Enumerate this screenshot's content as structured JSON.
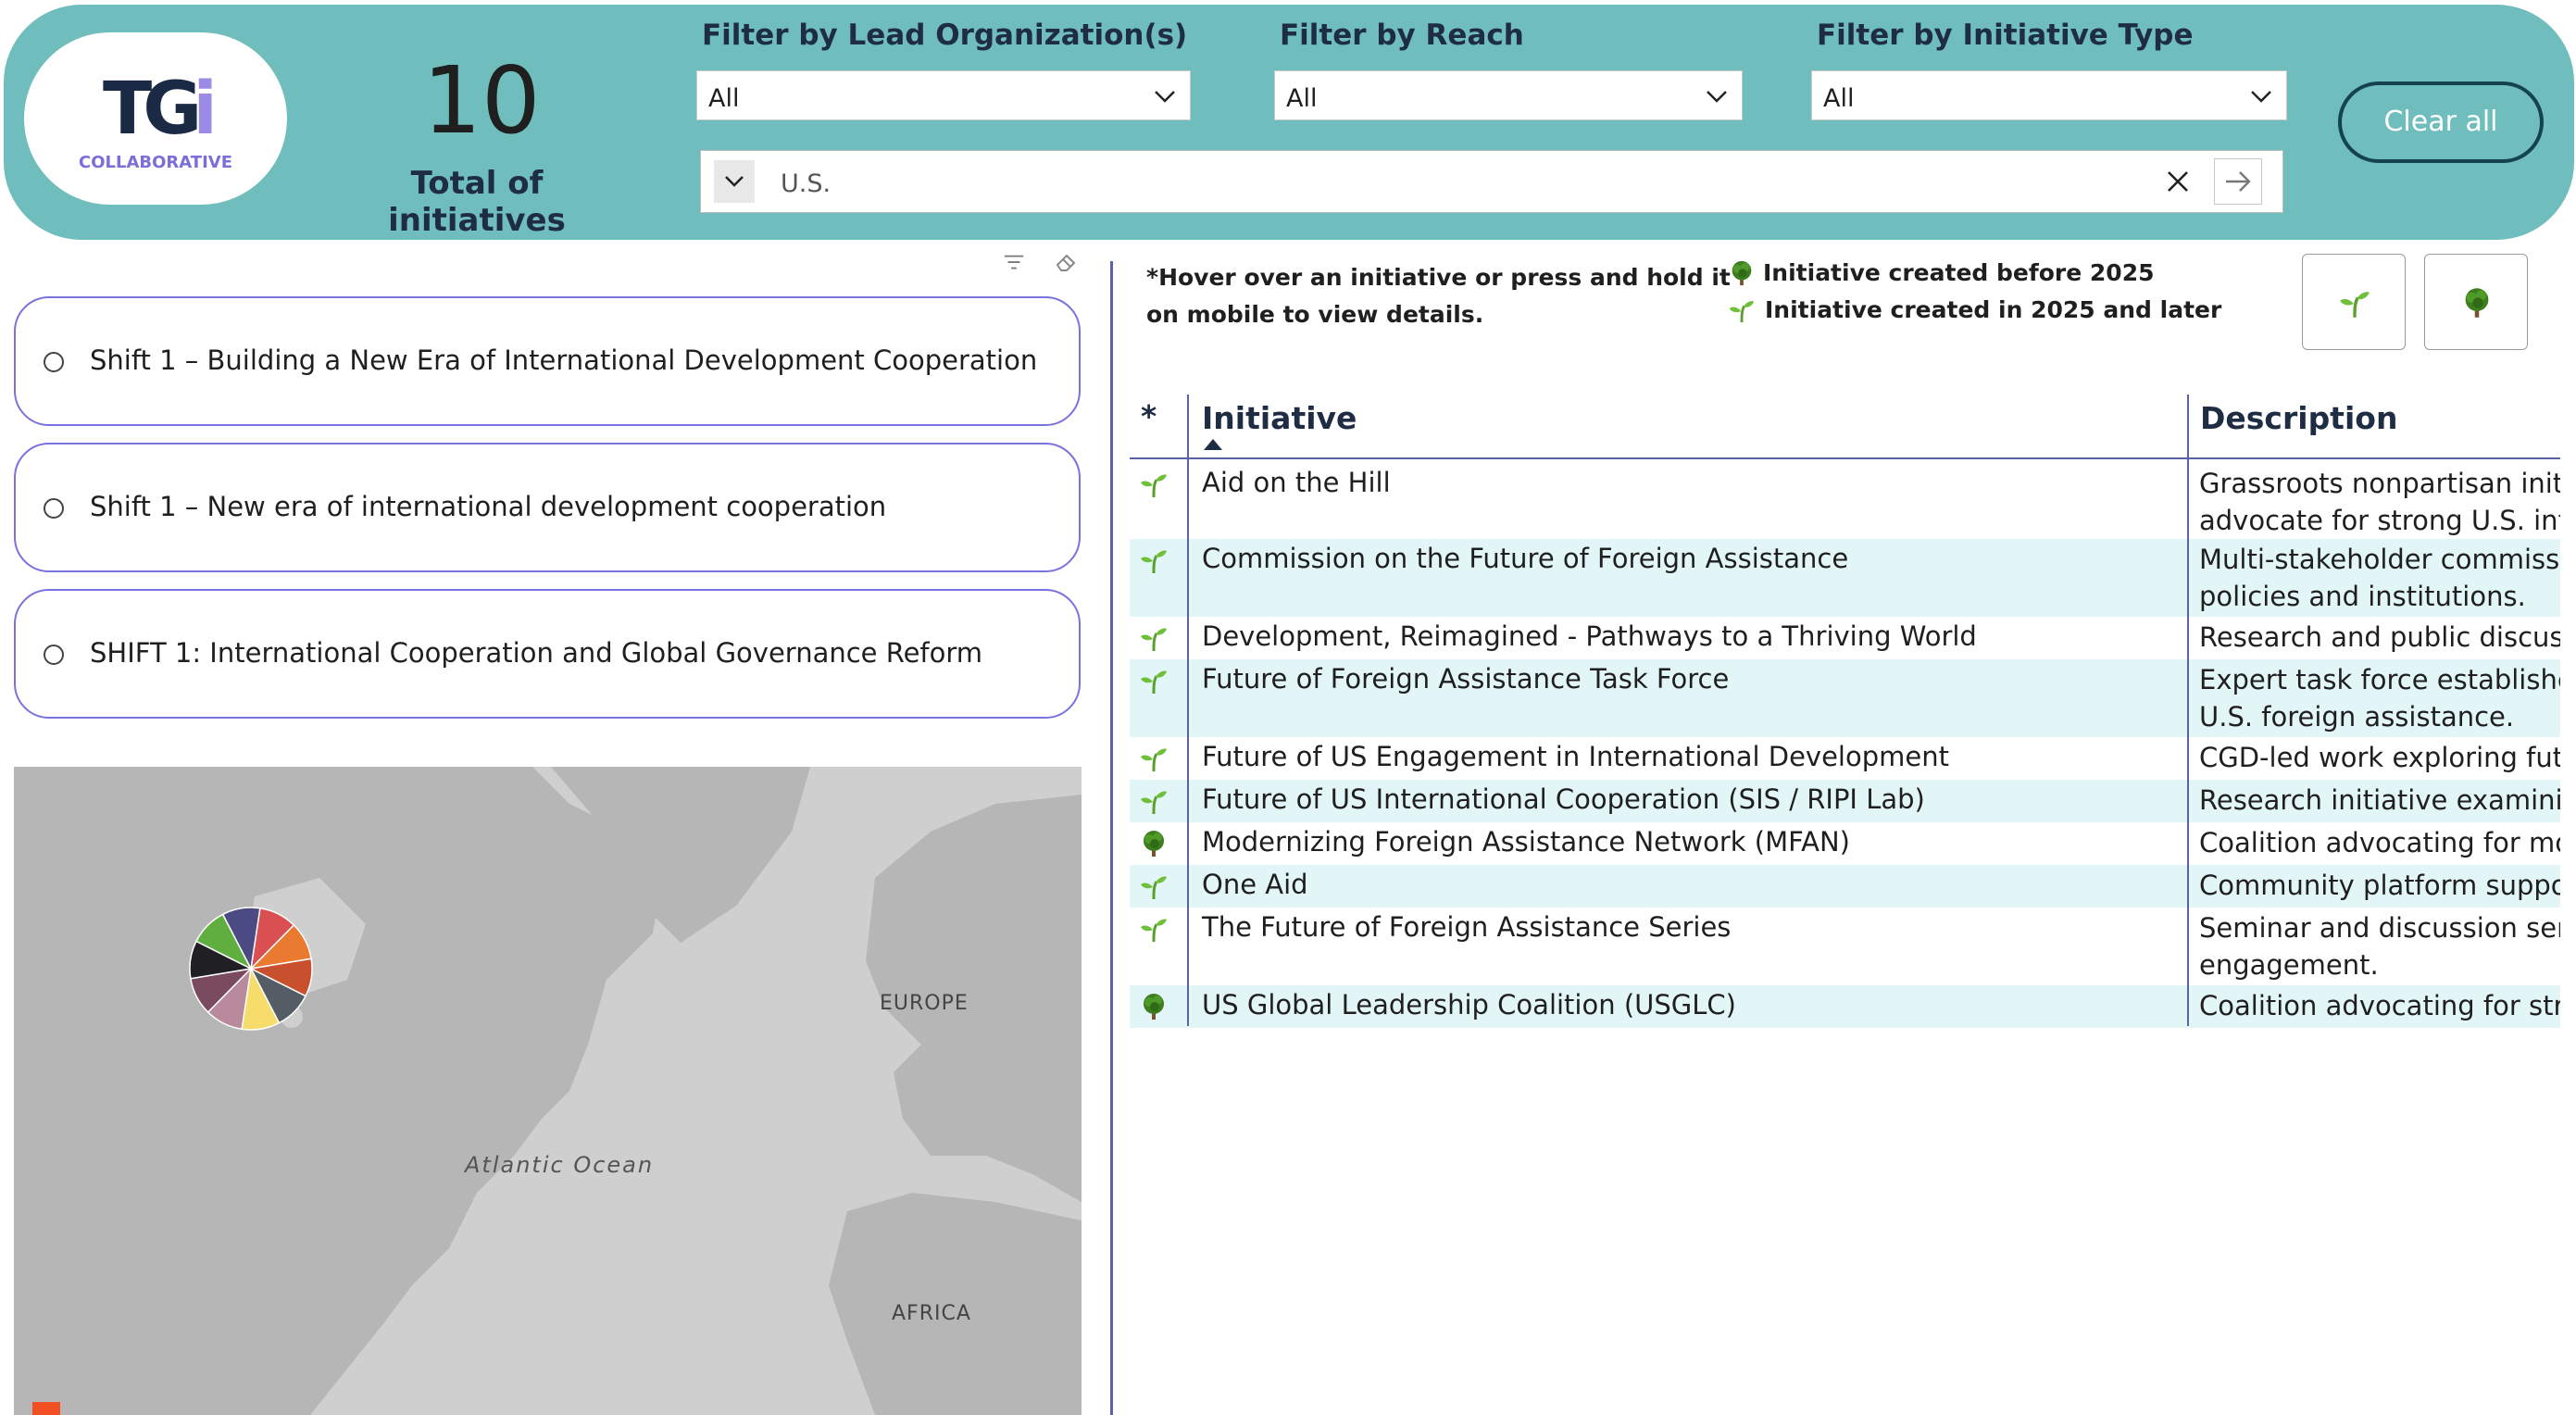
{
  "logo": {
    "word_a": "TG",
    "word_b": "i",
    "sub": "COLLABORATIVE"
  },
  "kpi": {
    "value": "10",
    "label": "Total of initiatives"
  },
  "filters": [
    {
      "title": "Filter by Lead Organization(s)",
      "value": "All"
    },
    {
      "title": "Filter by Reach",
      "value": "All"
    },
    {
      "title": "Filter by Initiative Type",
      "value": "All"
    }
  ],
  "search": {
    "value": "U.S."
  },
  "clear_label": "Clear all",
  "slicer": {
    "items": [
      "Shift 1 – Building a New Era of International Development Cooperation",
      "Shift 1 – New era of international development cooperation",
      "SHIFT 1: International Cooperation and Global Governance Reform"
    ]
  },
  "map": {
    "labels": {
      "europe": "EUROPE",
      "ocean": "Atlantic Ocean",
      "africa": "AFRICA"
    },
    "pie_colors": [
      "#d94f52",
      "#ea7a2f",
      "#c8502f",
      "#545d66",
      "#f6dc6b",
      "#b98a9b",
      "#7a4b5e",
      "#1f1f24",
      "#5fae3f",
      "#4c4a82"
    ]
  },
  "notes": {
    "hover": [
      "*Hover over an initiative or press and hold it",
      "on mobile to view details."
    ],
    "legend_before": "Initiative created before 2025",
    "legend_after": "Initiative created in 2025 and later"
  },
  "table": {
    "star_header": "*",
    "col_initiative": "Initiative",
    "col_description": "Description",
    "rows": [
      {
        "icon": "sprout",
        "name": "Aid on the Hill",
        "desc": [
          "Grassroots nonpartisan initiati",
          "advocate for strong U.S. intern"
        ]
      },
      {
        "icon": "sprout",
        "name": "Commission on the Future of Foreign Assistance",
        "desc": [
          "Multi-stakeholder commission",
          "policies and institutions."
        ]
      },
      {
        "icon": "sprout",
        "name": "Development, Reimagined - Pathways to a Thriving World",
        "desc": [
          "Research and public discussior"
        ]
      },
      {
        "icon": "sprout",
        "name": "Future of Foreign Assistance Task Force",
        "desc": [
          "Expert task force established t",
          "U.S. foreign assistance."
        ]
      },
      {
        "icon": "sprout",
        "name": "Future of US Engagement in International Development",
        "desc": [
          "CGD-led work exploring future"
        ]
      },
      {
        "icon": "sprout",
        "name": "Future of US International Cooperation (SIS / RIPI Lab)",
        "desc": [
          "Research initiative examining f"
        ]
      },
      {
        "icon": "tree",
        "name": "Modernizing Foreign Assistance Network (MFAN)",
        "desc": [
          "Coalition advocating for more"
        ]
      },
      {
        "icon": "sprout",
        "name": "One Aid",
        "desc": [
          "Community platform supporti"
        ]
      },
      {
        "icon": "sprout",
        "name": "The Future of Foreign Assistance Series",
        "desc": [
          "Seminar and discussion series",
          "engagement."
        ]
      },
      {
        "icon": "tree",
        "name": "US Global Leadership Coalition (USGLC)",
        "desc": [
          "Coalition advocating for strong"
        ]
      }
    ]
  }
}
